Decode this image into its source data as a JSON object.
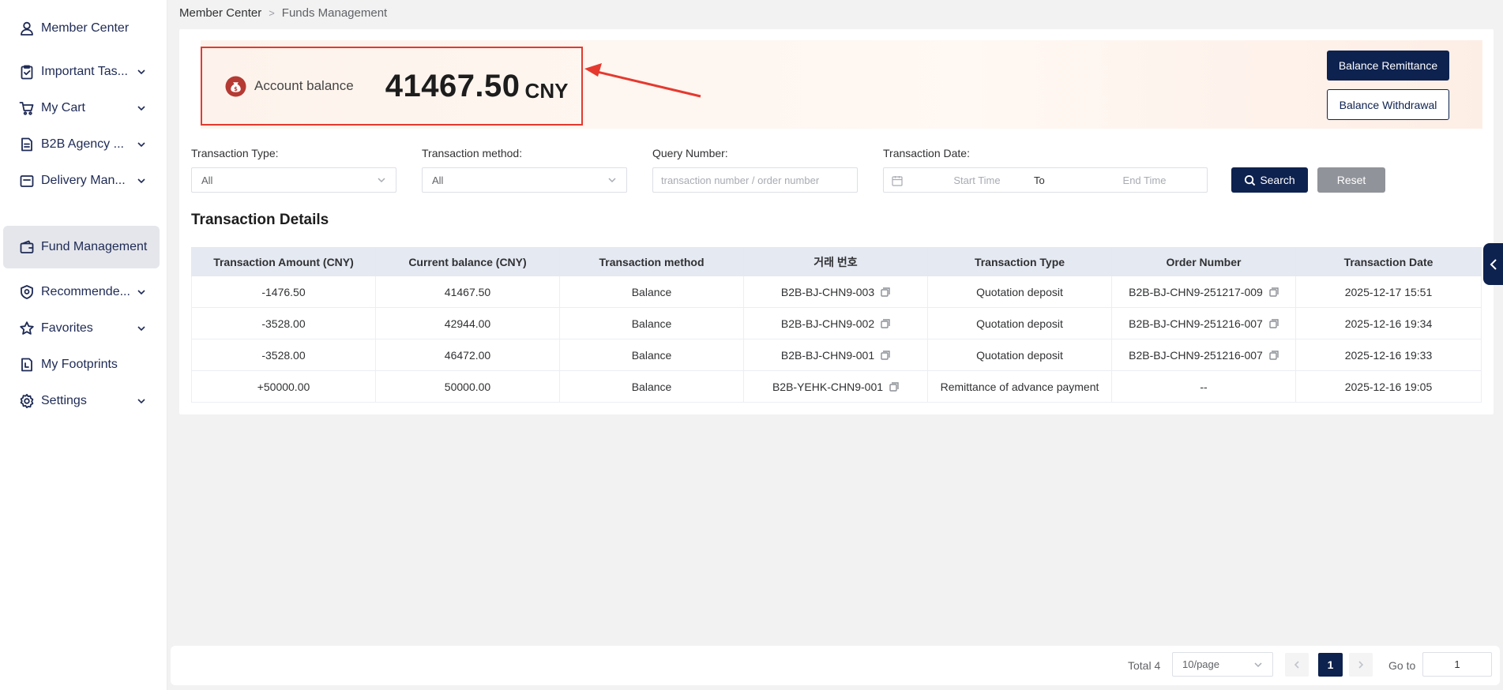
{
  "breadcrumb": {
    "root": "Member Center",
    "current": "Funds Management"
  },
  "sidebar": {
    "items": [
      {
        "label": "Member Center",
        "icon": "user-icon",
        "has_children": false
      },
      {
        "label": "Important Tas...",
        "icon": "clipboard-check-icon",
        "has_children": true
      },
      {
        "label": "My Cart",
        "icon": "cart-icon",
        "has_children": true
      },
      {
        "label": "B2B Agency ...",
        "icon": "document-icon",
        "has_children": true
      },
      {
        "label": "Delivery Man...",
        "icon": "folder-icon",
        "has_children": true
      },
      {
        "label": "Fund Management",
        "icon": "wallet-icon",
        "has_children": false,
        "active": true
      },
      {
        "label": "Recommende...",
        "icon": "badge-icon",
        "has_children": true
      },
      {
        "label": "Favorites",
        "icon": "star-icon",
        "has_children": true
      },
      {
        "label": "My Footprints",
        "icon": "footprint-doc-icon",
        "has_children": false
      },
      {
        "label": "Settings",
        "icon": "gear-icon",
        "has_children": true
      }
    ]
  },
  "balance": {
    "label": "Account balance",
    "amount": "41467.50",
    "currency": "CNY",
    "icon": "money-bag-icon"
  },
  "actions": {
    "remittance": "Balance Remittance",
    "withdrawal": "Balance Withdrawal"
  },
  "filters": {
    "type_label": "Transaction Type:",
    "type_value": "All",
    "method_label": "Transaction method:",
    "method_value": "All",
    "query_label": "Query Number:",
    "query_placeholder": "transaction number / order number",
    "date_label": "Transaction Date:",
    "date_start_placeholder": "Start Time",
    "date_to": "To",
    "date_end_placeholder": "End Time",
    "search": "Search",
    "reset": "Reset"
  },
  "section_title": "Transaction Details",
  "table": {
    "columns": [
      "Transaction Amount (CNY)",
      "Current balance (CNY)",
      "Transaction method",
      "거래 번호",
      "Transaction Type",
      "Order Number",
      "Transaction Date"
    ],
    "rows": [
      {
        "amount": "-1476.50",
        "sign": "neg",
        "balance": "41467.50",
        "method": "Balance",
        "txn_no": "B2B-BJ-CHN9-003",
        "type": "Quotation deposit",
        "order_no": "B2B-BJ-CHN9-251217-009",
        "date": "2025-12-17 15:51"
      },
      {
        "amount": "-3528.00",
        "sign": "neg",
        "balance": "42944.00",
        "method": "Balance",
        "txn_no": "B2B-BJ-CHN9-002",
        "type": "Quotation deposit",
        "order_no": "B2B-BJ-CHN9-251216-007",
        "date": "2025-12-16 19:34"
      },
      {
        "amount": "-3528.00",
        "sign": "neg",
        "balance": "46472.00",
        "method": "Balance",
        "txn_no": "B2B-BJ-CHN9-001",
        "type": "Quotation deposit",
        "order_no": "B2B-BJ-CHN9-251216-007",
        "date": "2025-12-16 19:33"
      },
      {
        "amount": "+50000.00",
        "sign": "pos",
        "balance": "50000.00",
        "method": "Balance",
        "txn_no": "B2B-YEHK-CHN9-001",
        "type": "Remittance of advance payment",
        "order_no": "--",
        "date": "2025-12-16 19:05"
      }
    ]
  },
  "pagination": {
    "total": "Total 4",
    "page_size": "10/page",
    "current_page": "1",
    "goto_label": "Go to",
    "goto_value": "1"
  },
  "colors": {
    "primary": "#0e224f",
    "highlight_border": "#e5392f",
    "negative": "#c0392b",
    "positive": "#4caf50"
  }
}
